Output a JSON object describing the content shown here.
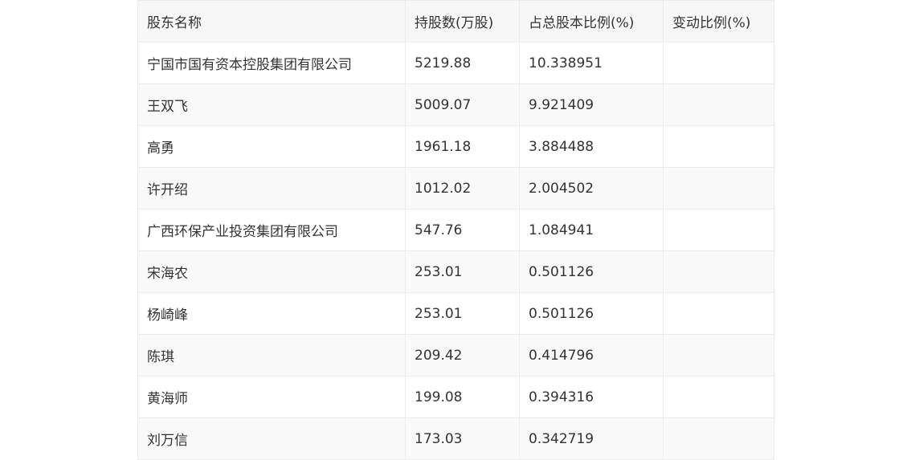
{
  "table": {
    "headers": [
      "股东名称",
      "持股数(万股)",
      "占总股本比例(%)",
      "变动比例(%)"
    ],
    "rows": [
      [
        "宁国市国有资本控股集团有限公司",
        "5219.88",
        "10.338951",
        ""
      ],
      [
        "王双飞",
        "5009.07",
        "9.921409",
        ""
      ],
      [
        "高勇",
        "1961.18",
        "3.884488",
        ""
      ],
      [
        "许开绍",
        "1012.02",
        "2.004502",
        ""
      ],
      [
        "广西环保产业投资集团有限公司",
        "547.76",
        "1.084941",
        ""
      ],
      [
        "宋海农",
        "253.01",
        "0.501126",
        ""
      ],
      [
        "杨崎峰",
        "253.01",
        "0.501126",
        ""
      ],
      [
        "陈琪",
        "209.42",
        "0.414796",
        ""
      ],
      [
        "黄海师",
        "199.08",
        "0.394316",
        ""
      ],
      [
        "刘万信",
        "173.03",
        "0.342719",
        ""
      ]
    ]
  }
}
